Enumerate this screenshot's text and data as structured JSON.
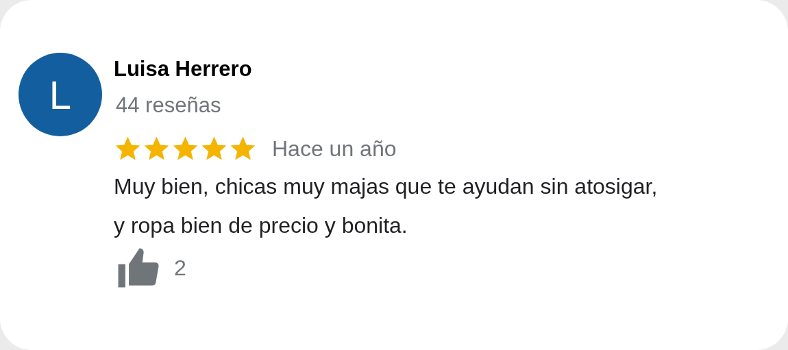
{
  "review": {
    "avatar_letter": "L",
    "author": "Luisa Herrero",
    "review_count": "44 reseñas",
    "stars": 5,
    "time": "Hace un año",
    "text": "Muy bien, chicas muy majas que te ayudan sin atosigar, y ropa bien de precio y bonita.",
    "likes": "2"
  }
}
